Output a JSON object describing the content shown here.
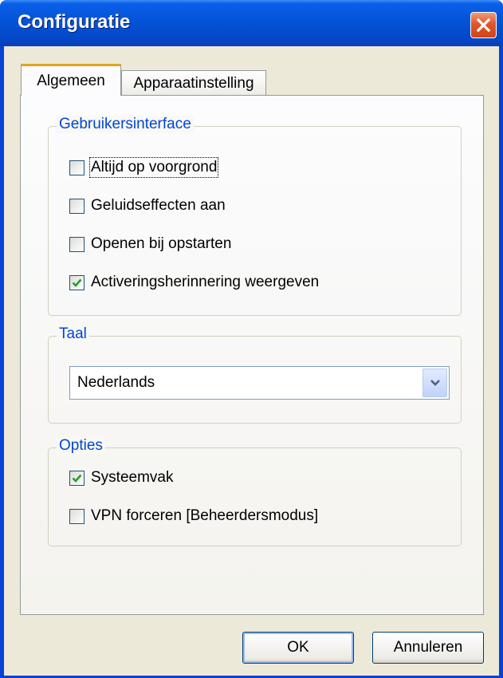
{
  "window": {
    "title": "Configuratie"
  },
  "tabs": [
    {
      "label": "Algemeen",
      "selected": true
    },
    {
      "label": "Apparaatinstelling",
      "selected": false
    }
  ],
  "ui_group": {
    "legend": "Gebruikersinterface",
    "options": [
      {
        "label": "Altijd op voorgrond",
        "checked": false
      },
      {
        "label": "Geluidseffecten aan",
        "checked": false
      },
      {
        "label": "Openen bij opstarten",
        "checked": false
      },
      {
        "label": "Activeringsherinnering weergeven",
        "checked": true
      }
    ]
  },
  "language_group": {
    "legend": "Taal",
    "selected": "Nederlands"
  },
  "options_group": {
    "legend": "Opties",
    "options": [
      {
        "label": "Systeemvak",
        "checked": true
      },
      {
        "label": "VPN forceren [Beheerdersmodus]",
        "checked": false
      }
    ]
  },
  "buttons": {
    "ok": "OK",
    "cancel": "Annuleren"
  },
  "colors": {
    "title_bar": "#0453d8",
    "dialog_bg": "#ece9d8",
    "legend_text": "#0046d5",
    "check_mark": "#21a121",
    "close_button": "#e0562a"
  }
}
